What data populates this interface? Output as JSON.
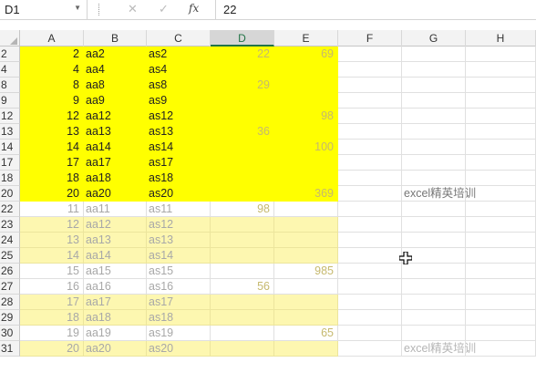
{
  "formula_bar": {
    "name_box": "D1",
    "formula_value": "22",
    "cancel_icon": "✕",
    "enter_icon": "✓",
    "fx_label": "fx"
  },
  "columns": [
    "A",
    "B",
    "C",
    "D",
    "E",
    "F",
    "G",
    "H"
  ],
  "selected_column": "D",
  "rows": [
    {
      "num": "2",
      "a": "2",
      "b": "aa2",
      "c": "as2",
      "d": "22",
      "e": "69",
      "g": "",
      "style": "yb"
    },
    {
      "num": "4",
      "a": "4",
      "b": "aa4",
      "c": "as4",
      "d": "",
      "e": "",
      "g": "",
      "style": "yb"
    },
    {
      "num": "8",
      "a": "8",
      "b": "aa8",
      "c": "as8",
      "d": "29",
      "e": "",
      "g": "",
      "style": "yb"
    },
    {
      "num": "9",
      "a": "9",
      "b": "aa9",
      "c": "as9",
      "d": "",
      "e": "",
      "g": "",
      "style": "yb"
    },
    {
      "num": "12",
      "a": "12",
      "b": "aa12",
      "c": "as12",
      "d": "",
      "e": "98",
      "g": "",
      "style": "yb"
    },
    {
      "num": "13",
      "a": "13",
      "b": "aa13",
      "c": "as13",
      "d": "36",
      "e": "",
      "g": "",
      "style": "yb"
    },
    {
      "num": "14",
      "a": "14",
      "b": "aa14",
      "c": "as14",
      "d": "",
      "e": "100",
      "g": "",
      "style": "yb"
    },
    {
      "num": "17",
      "a": "17",
      "b": "aa17",
      "c": "as17",
      "d": "",
      "e": "",
      "g": "",
      "style": "yb"
    },
    {
      "num": "18",
      "a": "18",
      "b": "aa18",
      "c": "as18",
      "d": "",
      "e": "",
      "g": "",
      "style": "yb"
    },
    {
      "num": "20",
      "a": "20",
      "b": "aa20",
      "c": "as20",
      "d": "",
      "e": "369",
      "g": "excel精英培训",
      "style": "yb"
    },
    {
      "num": "22",
      "a": "11",
      "b": "aa11",
      "c": "as11",
      "d": "98",
      "e": "",
      "g": "",
      "style": "white"
    },
    {
      "num": "23",
      "a": "12",
      "b": "aa12",
      "c": "as12",
      "d": "",
      "e": "",
      "g": "",
      "style": "yl"
    },
    {
      "num": "24",
      "a": "13",
      "b": "aa13",
      "c": "as13",
      "d": "",
      "e": "",
      "g": "",
      "style": "yl"
    },
    {
      "num": "25",
      "a": "14",
      "b": "aa14",
      "c": "as14",
      "d": "",
      "e": "",
      "g": "",
      "style": "yl"
    },
    {
      "num": "26",
      "a": "15",
      "b": "aa15",
      "c": "as15",
      "d": "",
      "e": "985",
      "g": "",
      "style": "white"
    },
    {
      "num": "27",
      "a": "16",
      "b": "aa16",
      "c": "as16",
      "d": "56",
      "e": "",
      "g": "",
      "style": "white"
    },
    {
      "num": "28",
      "a": "17",
      "b": "aa17",
      "c": "as17",
      "d": "",
      "e": "",
      "g": "",
      "style": "yl"
    },
    {
      "num": "29",
      "a": "18",
      "b": "aa18",
      "c": "as18",
      "d": "",
      "e": "",
      "g": "",
      "style": "yl"
    },
    {
      "num": "30",
      "a": "19",
      "b": "aa19",
      "c": "as19",
      "d": "",
      "e": "65",
      "g": "",
      "style": "white"
    },
    {
      "num": "31",
      "a": "20",
      "b": "aa20",
      "c": "as20",
      "d": "",
      "e": "",
      "g": "excel精英培训",
      "style": "yl"
    }
  ],
  "colors": {
    "highlight_yellow": "#ffff00",
    "light_yellow": "#fdf7b0",
    "selected_header_accent": "#217346"
  },
  "cursor_icon": "move-cross-cursor"
}
